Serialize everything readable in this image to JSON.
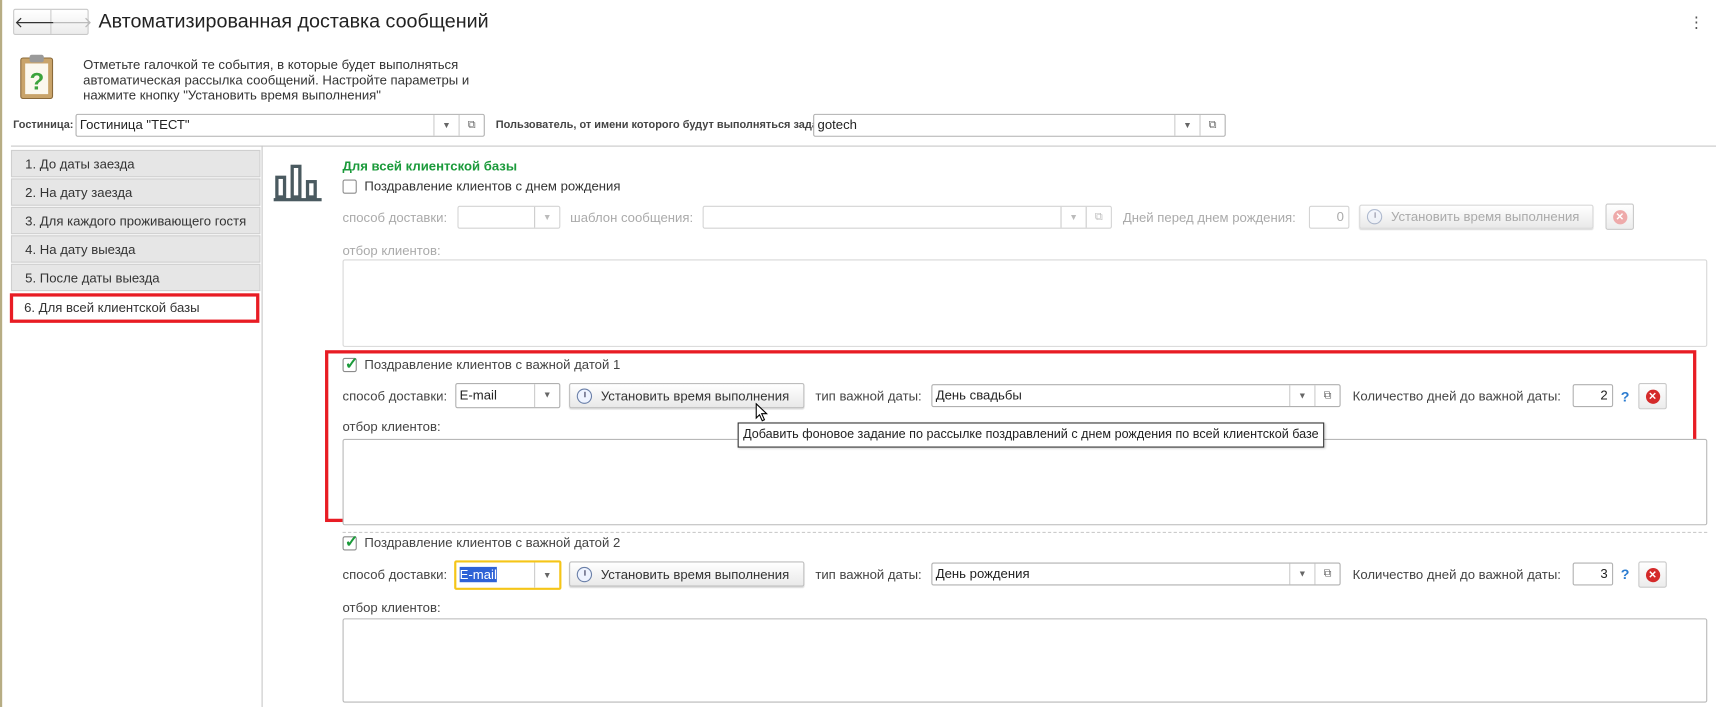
{
  "window": {
    "title": "Автоматизированная доставка сообщений",
    "back": "🡐",
    "forward": "🡒",
    "more": "⋮"
  },
  "info_text": [
    "Отметьте галочкой те события, в которые будет выполняться",
    "автоматическая рассылка сообщений. Настройте параметры и",
    "нажмите кнопку \"Установить время выполнения\""
  ],
  "hotel": {
    "label": "Гостиница:",
    "value": "Гостиница \"ТЕСТ\""
  },
  "user": {
    "label": "Пользователь, от имени которого будут выполняться задания:",
    "value": "gotech"
  },
  "tabs": [
    "1. До даты заезда",
    "2. На дату заезда",
    "3. Для каждого проживающего гостя",
    "4. На дату выезда",
    "5. После даты выезда",
    "6. Для всей клиентской базы"
  ],
  "section_title": "Для всей клиентской базы",
  "birthday": {
    "checkbox_label": "Поздравление клиентов с днем рождения",
    "checked": false,
    "delivery_label": "способ доставки:",
    "delivery_value": "",
    "template_label": "шаблон сообщения:",
    "template_value": "",
    "days_label": "Дней перед днем рождения:",
    "days_value": "0",
    "schedule_button": "Установить время выполнения",
    "filter_label": "отбор клиентов:"
  },
  "important1": {
    "checkbox_label": "Поздравление клиентов с важной датой 1",
    "checked": true,
    "delivery_label": "способ доставки:",
    "delivery_value": "E-mail",
    "schedule_button": "Установить время выполнения",
    "date_type_label": "тип важной даты:",
    "date_type_value": "День свадьбы",
    "days_label": "Количество дней до важной даты:",
    "days_value": "2",
    "help": "?",
    "filter_label": "отбор клиентов:"
  },
  "important2": {
    "checkbox_label": "Поздравление клиентов с важной датой 2",
    "checked": true,
    "delivery_label": "способ доставки:",
    "delivery_value": "E-mail",
    "schedule_button": "Установить время выполнения",
    "date_type_label": "тип важной даты:",
    "date_type_value": "День рождения",
    "days_label": "Количество дней до важной даты:",
    "days_value": "3",
    "help": "?",
    "filter_label": "отбор клиентов:"
  },
  "tooltip": "Добавить фоновое задание по рассылке поздравлений с днем рождения по всей клиентской базе",
  "colors": {
    "highlight": "#e81c24",
    "section_title": "#1a9a3a",
    "focus": "#f5c518"
  }
}
